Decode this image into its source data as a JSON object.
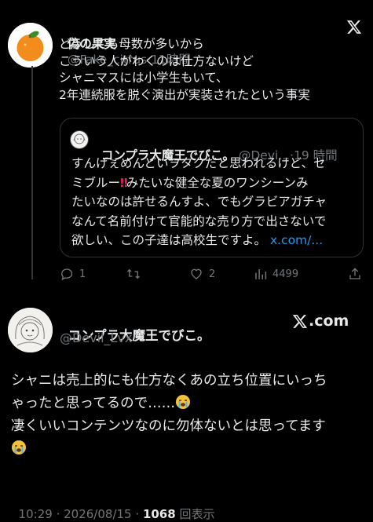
{
  "tweet1": {
    "display_name": "偽の果実",
    "handle": "@Fake_citrus",
    "separator": "·",
    "time": "11時間",
    "body_lines": [
      "どうしても母数が多いから",
      "こういう人がわくのは仕方ないけど",
      "シャニマスには小学生もいて、",
      "2年連続服を脱ぐ演出が実装されたという事実"
    ],
    "quote": {
      "display_name": "コンプラ大魔王でびこ。",
      "handle": "@Devi...",
      "separator": "·",
      "time": "19 時間",
      "body_lines": [
        "すんげぇめんどいヲタクだと思われるけど、セ",
        "ミブルー",
        "みたいな健全な夏のワンシーンみ",
        "たいなのは許せるんすよ、でもグラビアガチャ",
        "なんて名前付けて官能的な売り方で出さないで",
        "欲しい、この子達は高校生ですよ。"
      ],
      "link": "x.com/..."
    },
    "actions": {
      "reply_count": "1",
      "like_count": "2",
      "view_count": "4499"
    }
  },
  "tweet2": {
    "display_name": "コンプラ大魔王でびこ。",
    "handle": "@Devil_Lvx",
    "brand": "X.com",
    "body_line1": "シャニは売上的にも仕方なくあの立ち位置にいっち",
    "body_line2": "ゃったと思ってるので……",
    "body_line3": "凄くいいコンテンツなのに勿体ないとは思ってます",
    "footer": {
      "time": "10:29",
      "date": "2026/08/15",
      "separator": "·",
      "views": "1068",
      "views_label": "回表示"
    }
  },
  "colors": {
    "background": "#000000",
    "text": "#e7e9ea",
    "muted": "#71767b",
    "link": "#1d9bf0",
    "border": "#2f3336",
    "orange": "#f28c1c"
  },
  "icons": {
    "x_logo": "x-logo-icon",
    "reply": "speech-bubble-icon",
    "retweet": "repost-arrows-icon",
    "like": "heart-icon",
    "views": "bar-chart-icon",
    "share": "upload-icon",
    "emoji_red": "double-exclamation-emoji",
    "emoji_cry": "loudly-crying-face-emoji"
  }
}
